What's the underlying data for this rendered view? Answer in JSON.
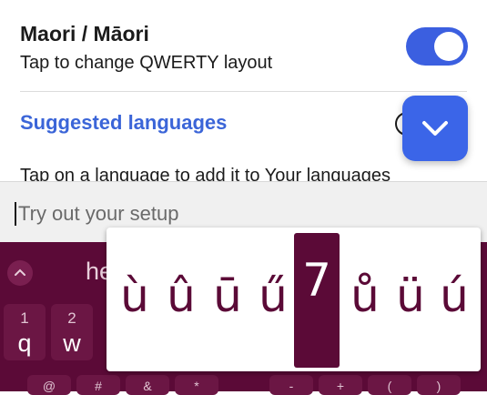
{
  "language_item": {
    "title": "Maori / Māori",
    "subtitle": "Tap to change QWERTY layout",
    "toggle_on": true
  },
  "suggested": {
    "title": "Suggested languages",
    "helper": "Tap on a language to add it to Your languages"
  },
  "input": {
    "placeholder": "Try out your setup"
  },
  "keyboard": {
    "suggestion": "he",
    "keys": [
      {
        "num": "1",
        "ch": "q"
      },
      {
        "num": "2",
        "ch": "w"
      }
    ],
    "row3_symbols": [
      "@",
      "#",
      "&",
      "*",
      "-",
      "+",
      "(",
      ")"
    ]
  },
  "accent_popup": {
    "options": [
      "ù",
      "û",
      "ū",
      "ű",
      "7",
      "ů",
      "ü",
      "ú"
    ],
    "selected": "7"
  },
  "colors": {
    "accent_blue": "#3b65e8",
    "keyboard_bg": "#5b0a37"
  },
  "icons": {
    "fab": "chevron-down-icon",
    "expand": "chevron-up-icon",
    "info": "info-icon"
  }
}
